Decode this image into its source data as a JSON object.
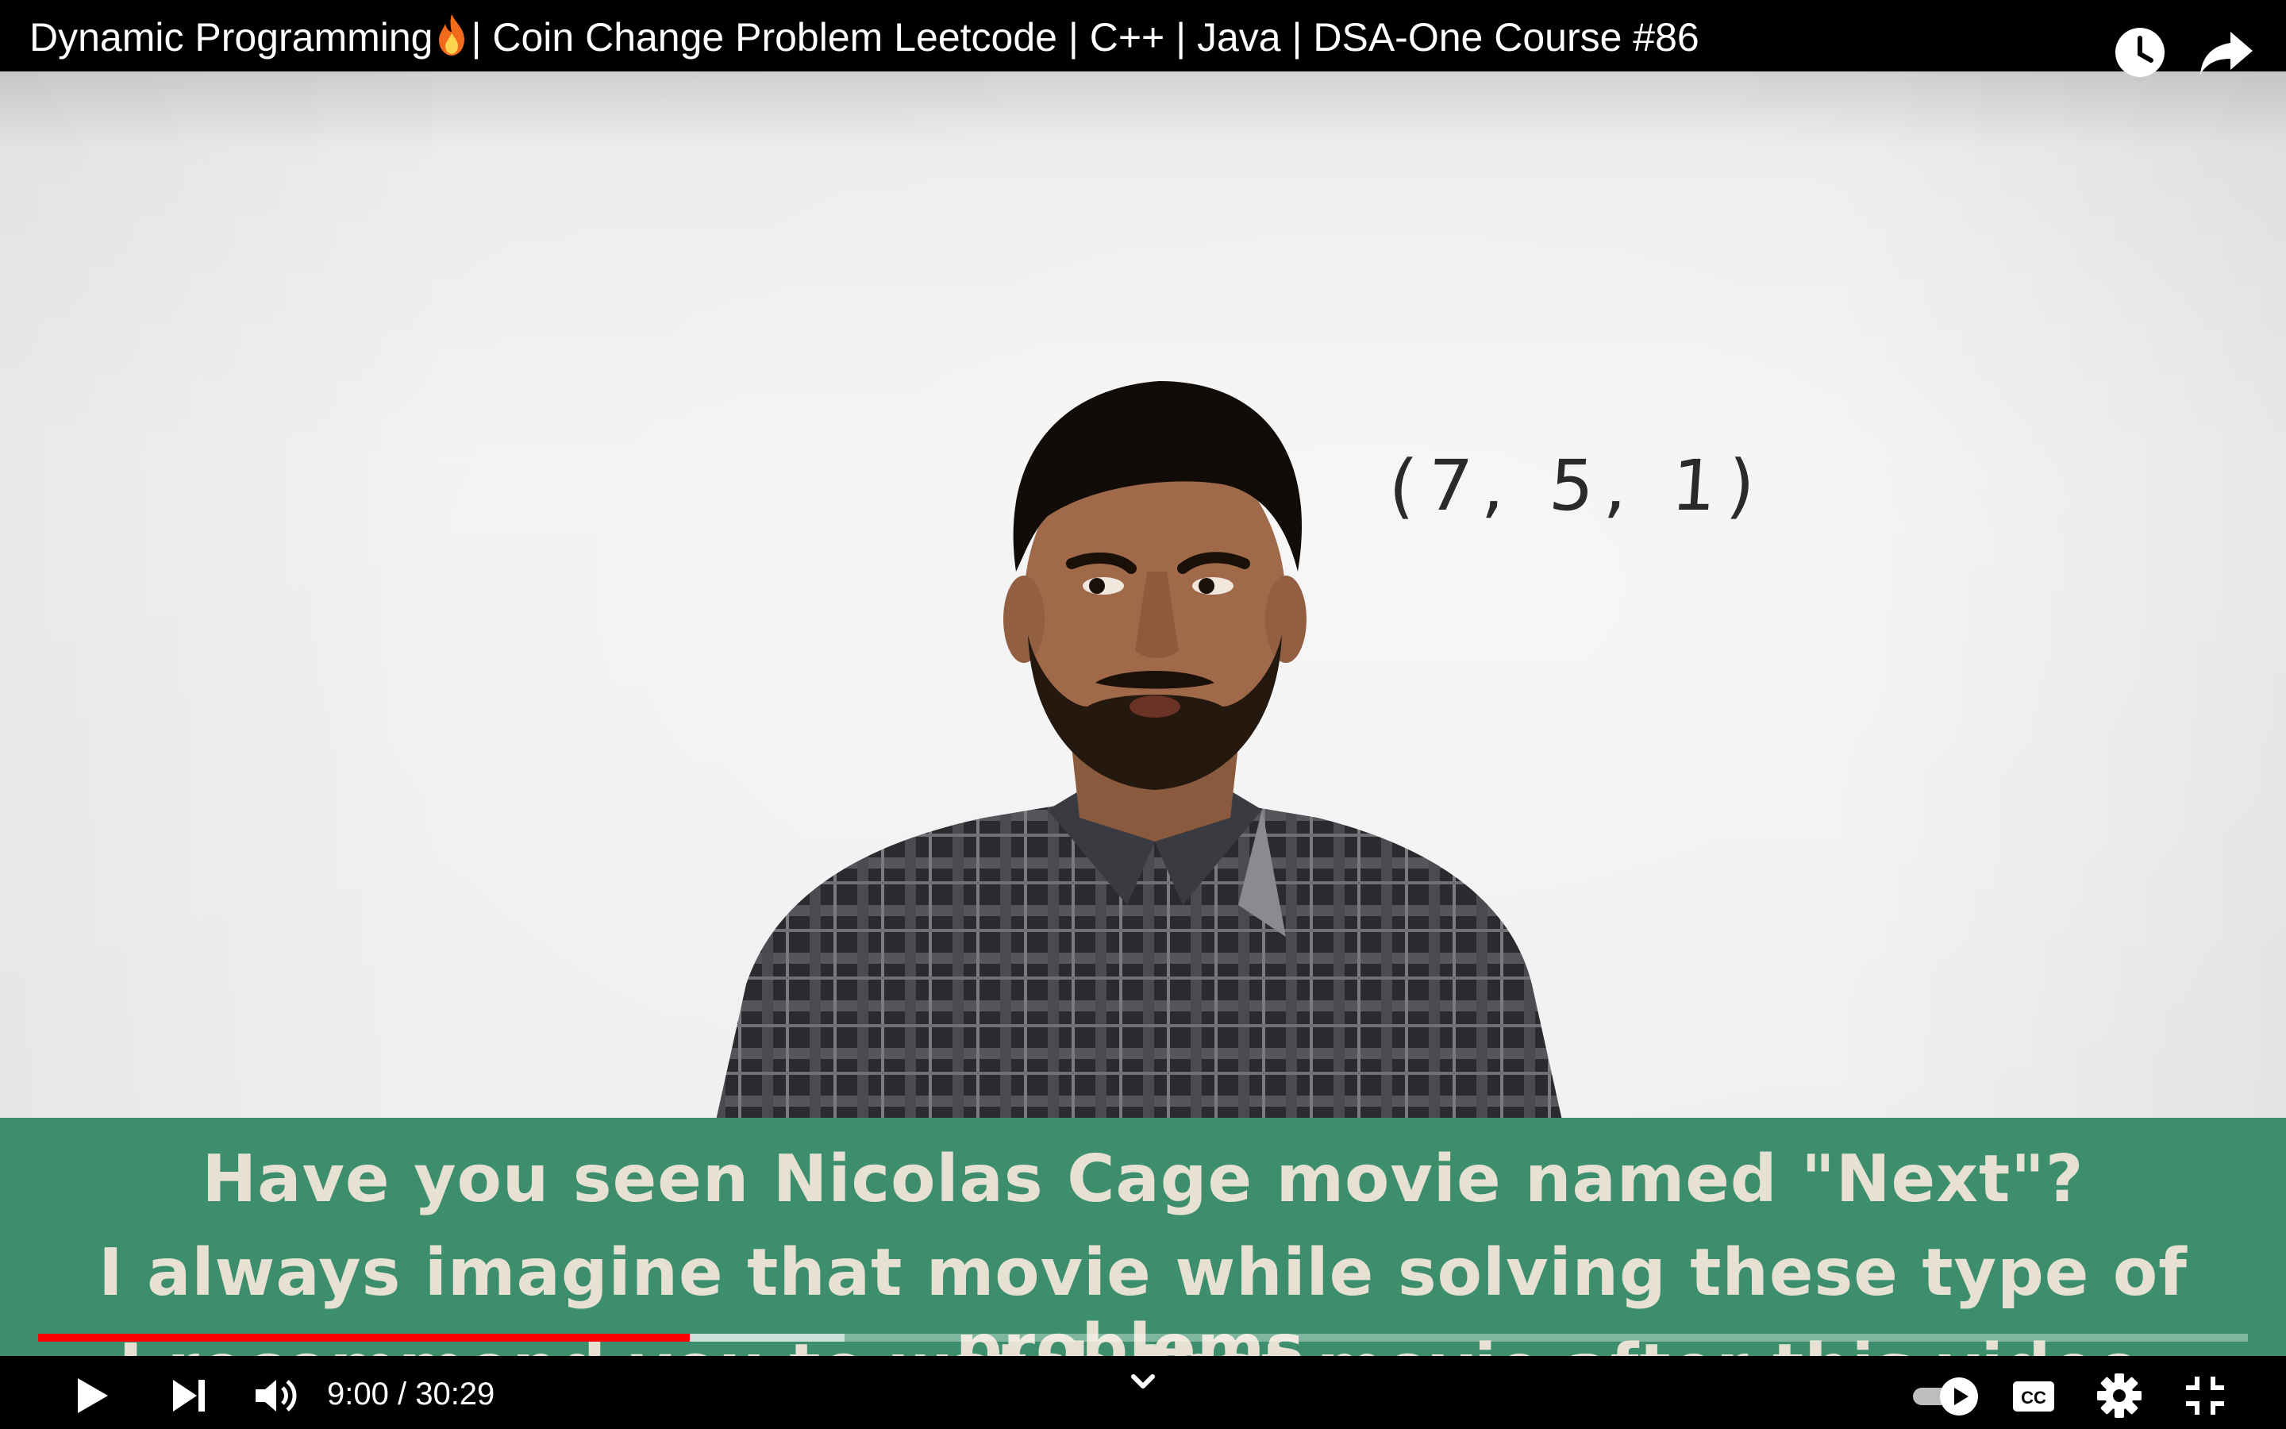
{
  "video": {
    "title": "Dynamic Programming",
    "title_rest": "| Coin Change Problem Leetcode | C++ | Java | DSA-One Course #86",
    "title_emoji_icon": "fire-icon",
    "whiteboard_text": "(7, 5, 1)"
  },
  "caption": {
    "lines": [
      "Have you seen Nicolas Cage movie named \"Next\"?",
      "I always imagine that movie while solving these type of problems.",
      "I recommend you to watch that movie after this video."
    ],
    "background_color": "#3c8e6c"
  },
  "player": {
    "current_time": "9:00",
    "separator": " / ",
    "duration": "30:29",
    "progress_played_fraction": 0.295,
    "progress_buffered_fraction": 0.365,
    "accent_color": "#ff0000",
    "icons": {
      "watch_later": "clock-icon",
      "share": "share-arrow-icon",
      "play": "play-icon",
      "next": "skip-next-icon",
      "volume": "volume-icon",
      "chevron": "chevron-down-icon",
      "autoplay": "autoplay-toggle-icon",
      "captions": "cc-icon",
      "settings": "gear-icon",
      "exit_fullscreen": "exit-fullscreen-icon"
    }
  }
}
